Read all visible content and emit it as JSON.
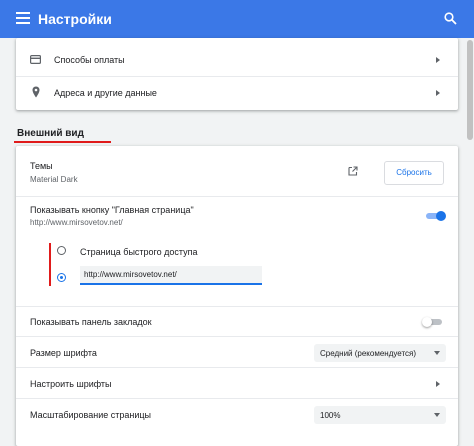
{
  "header": {
    "title": "Настройки",
    "menu_icon": "menu-icon",
    "search_icon": "search-icon",
    "color": "#3b78e7"
  },
  "autofill": {
    "items": [
      {
        "label": "Способы оплаты",
        "icon": "credit-card-icon"
      },
      {
        "label": "Адреса и другие данные",
        "icon": "location-pin-icon"
      }
    ]
  },
  "appearance": {
    "section_title": "Внешний вид",
    "themes": {
      "label": "Темы",
      "value": "Material Dark",
      "reset_label": "Сбросить"
    },
    "home_button": {
      "label": "Показывать кнопку \"Главная страница\"",
      "url": "http://www.mirsovetov.net/",
      "enabled": true
    },
    "home_options": {
      "ntp_label": "Страница быстрого доступа",
      "custom_url_value": "http://www.mirsovetov.net/",
      "selected": "custom"
    },
    "bookmarks_bar": {
      "label": "Показывать панель закладок",
      "enabled": false
    },
    "font_size": {
      "label": "Размер шрифта",
      "value": "Средний (рекомендуется)"
    },
    "customize_fonts": {
      "label": "Настроить шрифты"
    },
    "page_zoom": {
      "label": "Масштабирование страницы",
      "value": "100%"
    }
  },
  "accent_color": "#1a73e8",
  "annotation_color": "#e01b1b"
}
